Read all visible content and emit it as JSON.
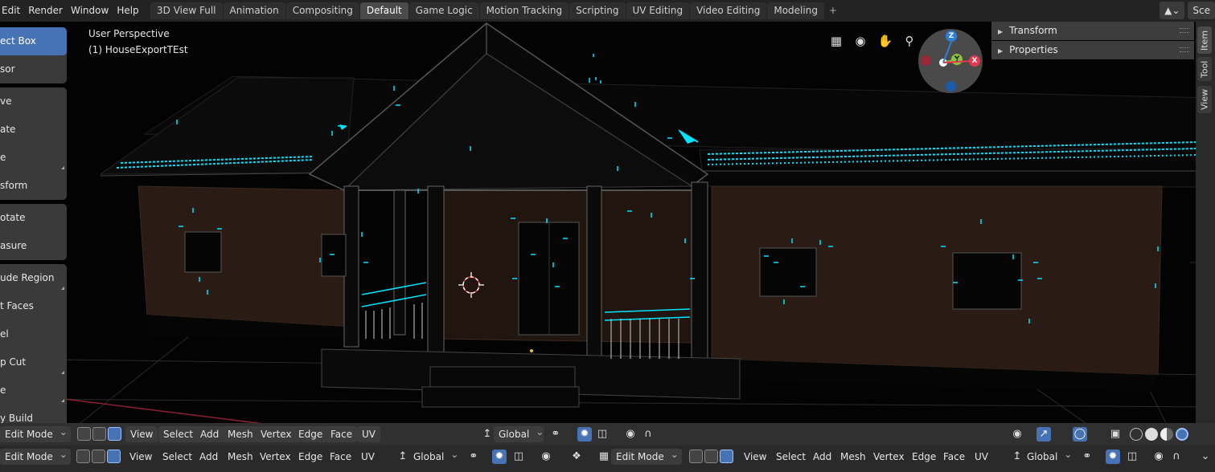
{
  "menu": [
    "Edit",
    "Render",
    "Window",
    "Help"
  ],
  "workspaces": [
    {
      "label": "3D View Full",
      "active": false
    },
    {
      "label": "Animation",
      "active": false
    },
    {
      "label": "Compositing",
      "active": false
    },
    {
      "label": "Default",
      "active": true
    },
    {
      "label": "Game Logic",
      "active": false
    },
    {
      "label": "Motion Tracking",
      "active": false
    },
    {
      "label": "Scripting",
      "active": false
    },
    {
      "label": "UV Editing",
      "active": false
    },
    {
      "label": "Video Editing",
      "active": false
    },
    {
      "label": "Modeling",
      "active": false
    }
  ],
  "workspace_add": "+",
  "scene_label": "Sce",
  "viewport": {
    "view_name": "User Perspective",
    "object_name": "(1) HouseExportTEst"
  },
  "toolbar": {
    "groups": [
      [
        {
          "label": "ect Box",
          "active": true,
          "sub": false
        },
        {
          "label": "sor",
          "active": false,
          "sub": false
        }
      ],
      [
        {
          "label": "ve",
          "active": false,
          "sub": false
        },
        {
          "label": "ate",
          "active": false,
          "sub": false
        },
        {
          "label": "e",
          "active": false,
          "sub": true
        },
        {
          "label": "sform",
          "active": false,
          "sub": false
        }
      ],
      [
        {
          "label": "otate",
          "active": false,
          "sub": false
        },
        {
          "label": "asure",
          "active": false,
          "sub": false
        }
      ],
      [
        {
          "label": "ude Region",
          "active": false,
          "sub": true
        },
        {
          "label": "t Faces",
          "active": false,
          "sub": false
        },
        {
          "label": "el",
          "active": false,
          "sub": false
        },
        {
          "label": "p Cut",
          "active": false,
          "sub": true
        },
        {
          "label": "e",
          "active": false,
          "sub": true
        },
        {
          "label": "y Build",
          "active": false,
          "sub": false
        }
      ]
    ]
  },
  "gizmo": {
    "z": "Z",
    "y": "Y",
    "x": "X",
    "colors": {
      "x": "#e5384f",
      "y": "#8bc53f",
      "z": "#2d7fd9"
    }
  },
  "n_panel": {
    "sections": [
      "Transform",
      "Properties"
    ]
  },
  "side_tabs": [
    "Item",
    "Tool",
    "View"
  ],
  "header": {
    "mode": "Edit Mode",
    "menus": [
      "View",
      "Select",
      "Add",
      "Mesh",
      "Vertex",
      "Edge",
      "Face",
      "UV"
    ],
    "orientation": "Global"
  },
  "header2": {
    "mode": "Edit Mode",
    "menus": [
      "View",
      "Select",
      "Add",
      "Mesh",
      "Vertex",
      "Edge",
      "Face",
      "UV"
    ],
    "orientation": "Global",
    "mode_right": "Edit Mode",
    "menus_right": [
      "View",
      "Select",
      "Add",
      "Mesh",
      "Vertex",
      "Edge",
      "Face",
      "UV"
    ],
    "orientation_right": "Global"
  },
  "colors": {
    "accent": "#4772b3",
    "selection": "#00e5ff",
    "wall": "#2a1b14"
  }
}
